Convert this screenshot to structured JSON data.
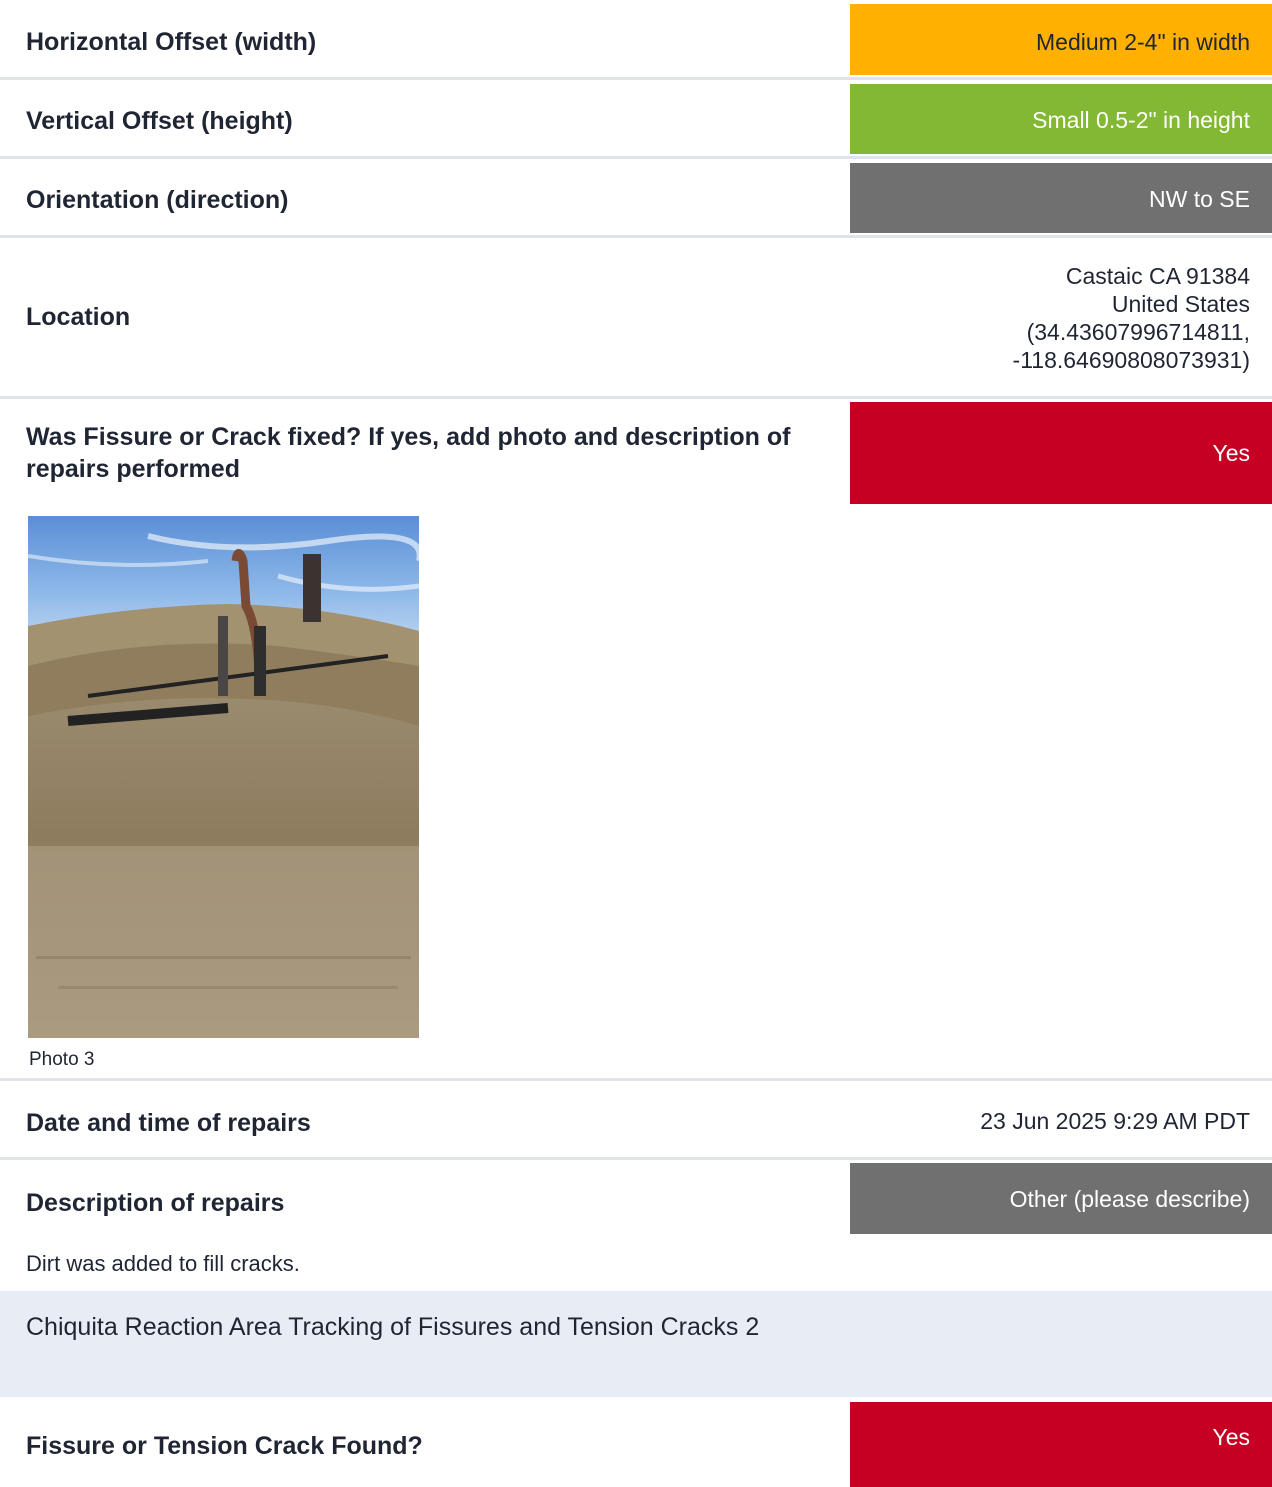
{
  "rows": {
    "horizontal": {
      "label": "Horizontal Offset (width)",
      "value": "Medium 2-4\" in width",
      "color": "#ffb000",
      "text_color": "#1f2533"
    },
    "vertical": {
      "label": "Vertical Offset (height)",
      "value": "Small 0.5-2\" in height",
      "color": "#82b833",
      "text_color": "#ffffff"
    },
    "orientation": {
      "label": "Orientation (direction)",
      "value": "NW to SE",
      "color": "#707070",
      "text_color": "#ffffff"
    },
    "location": {
      "label": "Location",
      "lines": [
        "Castaic CA 91384",
        "United States",
        "(34.43607996714811,",
        "-118.64690808073931)"
      ]
    },
    "fixed": {
      "label": "Was Fissure or Crack fixed? If yes, add photo and description of repairs performed",
      "value": "Yes",
      "color": "#c50023"
    },
    "date": {
      "label": "Date and time of repairs",
      "value": "23 Jun 2025 9:29 AM PDT"
    },
    "description": {
      "label": "Description of repairs",
      "value": "Other (please describe)",
      "color": "#707070"
    },
    "found": {
      "label": "Fissure or Tension Crack Found?",
      "value": "Yes",
      "color": "#c50023"
    }
  },
  "photo": {
    "caption": "Photo 3"
  },
  "description_text": "Dirt was added to fill cracks.",
  "section": {
    "title": "Chiquita Reaction Area Tracking of Fissures and Tension Cracks 2"
  }
}
